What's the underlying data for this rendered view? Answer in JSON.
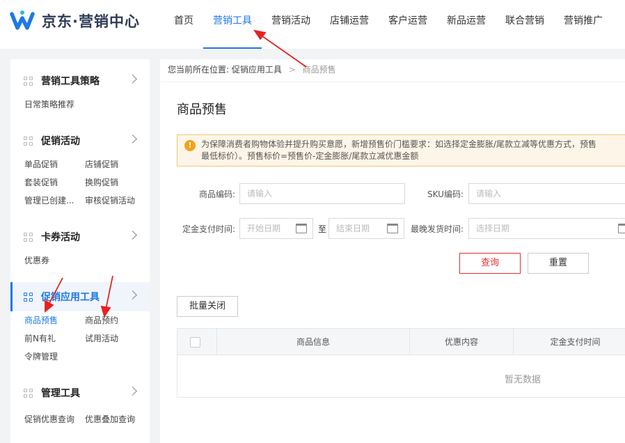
{
  "app": {
    "brand": "京东·营销中心"
  },
  "nav": {
    "items": [
      "首页",
      "营销工具",
      "营销活动",
      "店铺运营",
      "客户运营",
      "新品运营",
      "联合营销",
      "营销推广"
    ],
    "active_index": 1
  },
  "sidebar": {
    "groups": [
      {
        "title": "营销工具策略",
        "items": [
          "日常策略推荐"
        ]
      },
      {
        "title": "促销活动",
        "items": [
          "单品促销",
          "店铺促销",
          "套装促销",
          "换购促销",
          "管理已创建...",
          "审核促销活动"
        ]
      },
      {
        "title": "卡券活动",
        "items": [
          "优惠券"
        ]
      },
      {
        "title": "促销应用工具",
        "items": [
          "商品预售",
          "商品预约",
          "前N有礼",
          "试用活动",
          "令牌管理"
        ]
      },
      {
        "title": "管理工具",
        "items": [
          "促销优惠查询",
          "优惠叠加查询"
        ]
      }
    ],
    "active_group": 3,
    "active_item": "商品预售"
  },
  "breadcrumb": {
    "prefix": "您当前所在位置:",
    "parent": "促销应用工具",
    "current": "商品预售"
  },
  "page": {
    "title": "商品预售"
  },
  "notice": {
    "icon": "!",
    "line1": "为保障消费者购物体验并提升购买意愿，新增预售价门槛要求：如选择定金膨胀/尾款立减等优惠方式，预售",
    "line2": "最低标价）。预售标价=预售价-定金膨胀/尾款立减优惠金额"
  },
  "form": {
    "product_code_label": "商品编码:",
    "product_code_placeholder": "请输入",
    "sku_label": "SKU编码:",
    "sku_placeholder": "请输入",
    "deposit_time_label": "定金支付时间:",
    "start_date_placeholder": "开始日期",
    "to_text": "至",
    "end_date_placeholder": "结束日期",
    "latest_ship_label": "最晚发货时间:",
    "select_date_placeholder": "选择日期",
    "query_label": "查询",
    "reset_label": "重置"
  },
  "batch_close_label": "批量关闭",
  "table": {
    "columns": [
      "商品信息",
      "优惠内容",
      "定金支付时间"
    ],
    "empty_text": "暂无数据"
  },
  "colors": {
    "accent": "#1e78e6",
    "danger": "#e2302f",
    "annotation_arrow": "#e8201e"
  }
}
